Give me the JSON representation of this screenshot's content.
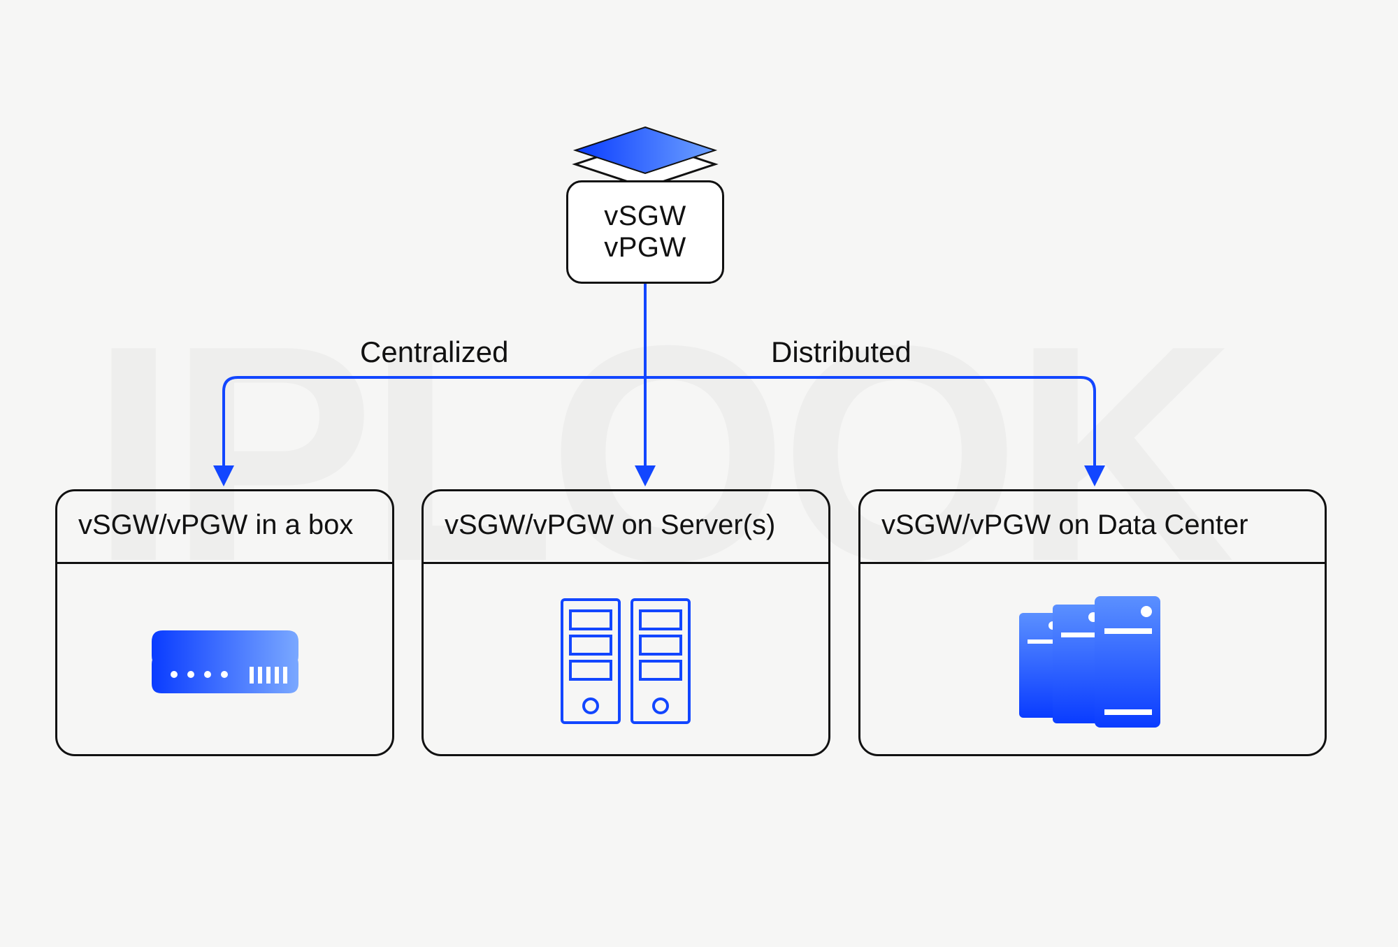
{
  "watermark_text": "IPLOOK",
  "top_node": {
    "line1": "vSGW",
    "line2": "vPGW"
  },
  "edges": {
    "left_label": "Centralized",
    "right_label": "Distributed"
  },
  "cards": [
    {
      "title": "vSGW/vPGW in a box",
      "icon": "appliance-box-icon"
    },
    {
      "title": "vSGW/vPGW on Server(s)",
      "icon": "servers-icon"
    },
    {
      "title": "vSGW/vPGW on Data Center",
      "icon": "datacenter-towers-icon"
    }
  ],
  "colors": {
    "accent": "#1246ff",
    "accent_light": "#3e77ff",
    "stroke": "#111111"
  }
}
